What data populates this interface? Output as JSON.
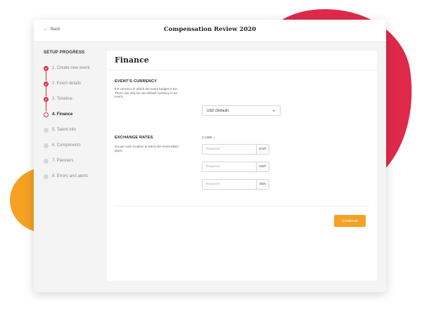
{
  "header": {
    "back_label": "Back",
    "title": "Compensation Review 2020"
  },
  "sidebar": {
    "heading": "SETUP PROGRESS",
    "steps": [
      {
        "label": "1. Create new event",
        "status": "done"
      },
      {
        "label": "2. Event details",
        "status": "done"
      },
      {
        "label": "3. Timeline",
        "status": "done"
      },
      {
        "label": "4. Finance",
        "status": "current"
      },
      {
        "label": "5. Talent info",
        "status": "todo"
      },
      {
        "label": "6. Components",
        "status": "todo"
      },
      {
        "label": "7. Planners",
        "status": "todo"
      },
      {
        "label": "8. Errors and alerts",
        "status": "todo"
      }
    ]
  },
  "main": {
    "title": "Finance",
    "currency": {
      "label": "EVENT'S CURRENCY",
      "description": "the currency in which the event budget is set. There can only be one default currency in an event.",
      "selected": "USD (Default)"
    },
    "exchange": {
      "label": "EXCHANGE RATES",
      "description": "set per each location in which the event takes place.",
      "base": "1 USD =",
      "rates": [
        {
          "placeholder": "Required",
          "currency": "EUR"
        },
        {
          "placeholder": "Required",
          "currency": "GBP"
        },
        {
          "placeholder": "Required",
          "currency": "SEK"
        }
      ]
    },
    "continue_label": "Continue"
  },
  "colors": {
    "accent_red": "#e0294a",
    "accent_orange": "#f5a124"
  }
}
